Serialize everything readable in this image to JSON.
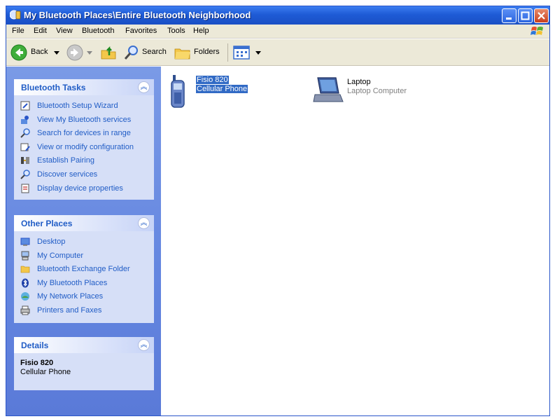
{
  "window": {
    "title": "My Bluetooth Places\\Entire Bluetooth Neighborhood"
  },
  "menu": [
    "File",
    "Edit",
    "View",
    "Bluetooth",
    "Favorites",
    "Tools",
    "Help"
  ],
  "toolbar": {
    "back_label": "Back",
    "search_label": "Search",
    "folders_label": "Folders"
  },
  "bluetooth_tasks": {
    "title": "Bluetooth Tasks",
    "items": [
      {
        "label": "Bluetooth Setup Wizard",
        "icon": "wizard-icon"
      },
      {
        "label": "View My Bluetooth services",
        "icon": "services-icon"
      },
      {
        "label": "Search for devices in range",
        "icon": "search-icon"
      },
      {
        "label": "View or modify configuration",
        "icon": "configuration-icon"
      },
      {
        "label": "Establish Pairing",
        "icon": "pairing-icon"
      },
      {
        "label": "Discover services",
        "icon": "search-icon"
      },
      {
        "label": "Display device properties",
        "icon": "properties-icon"
      }
    ]
  },
  "other_places": {
    "title": "Other Places",
    "items": [
      {
        "label": "Desktop",
        "icon": "desktop-icon"
      },
      {
        "label": "My Computer",
        "icon": "computer-icon"
      },
      {
        "label": "Bluetooth Exchange Folder",
        "icon": "folder-icon"
      },
      {
        "label": "My Bluetooth Places",
        "icon": "bluetooth-icon"
      },
      {
        "label": "My Network Places",
        "icon": "network-icon"
      },
      {
        "label": "Printers and Faxes",
        "icon": "printer-icon"
      }
    ]
  },
  "details": {
    "title": "Details",
    "name": "Fisio 820",
    "type": "Cellular Phone"
  },
  "devices": [
    {
      "name": "Fisio 820",
      "type": "Cellular Phone",
      "icon": "cellphone-icon",
      "selected": true
    },
    {
      "name": "Laptop",
      "type": "Laptop Computer",
      "icon": "laptop-icon",
      "selected": false
    }
  ]
}
